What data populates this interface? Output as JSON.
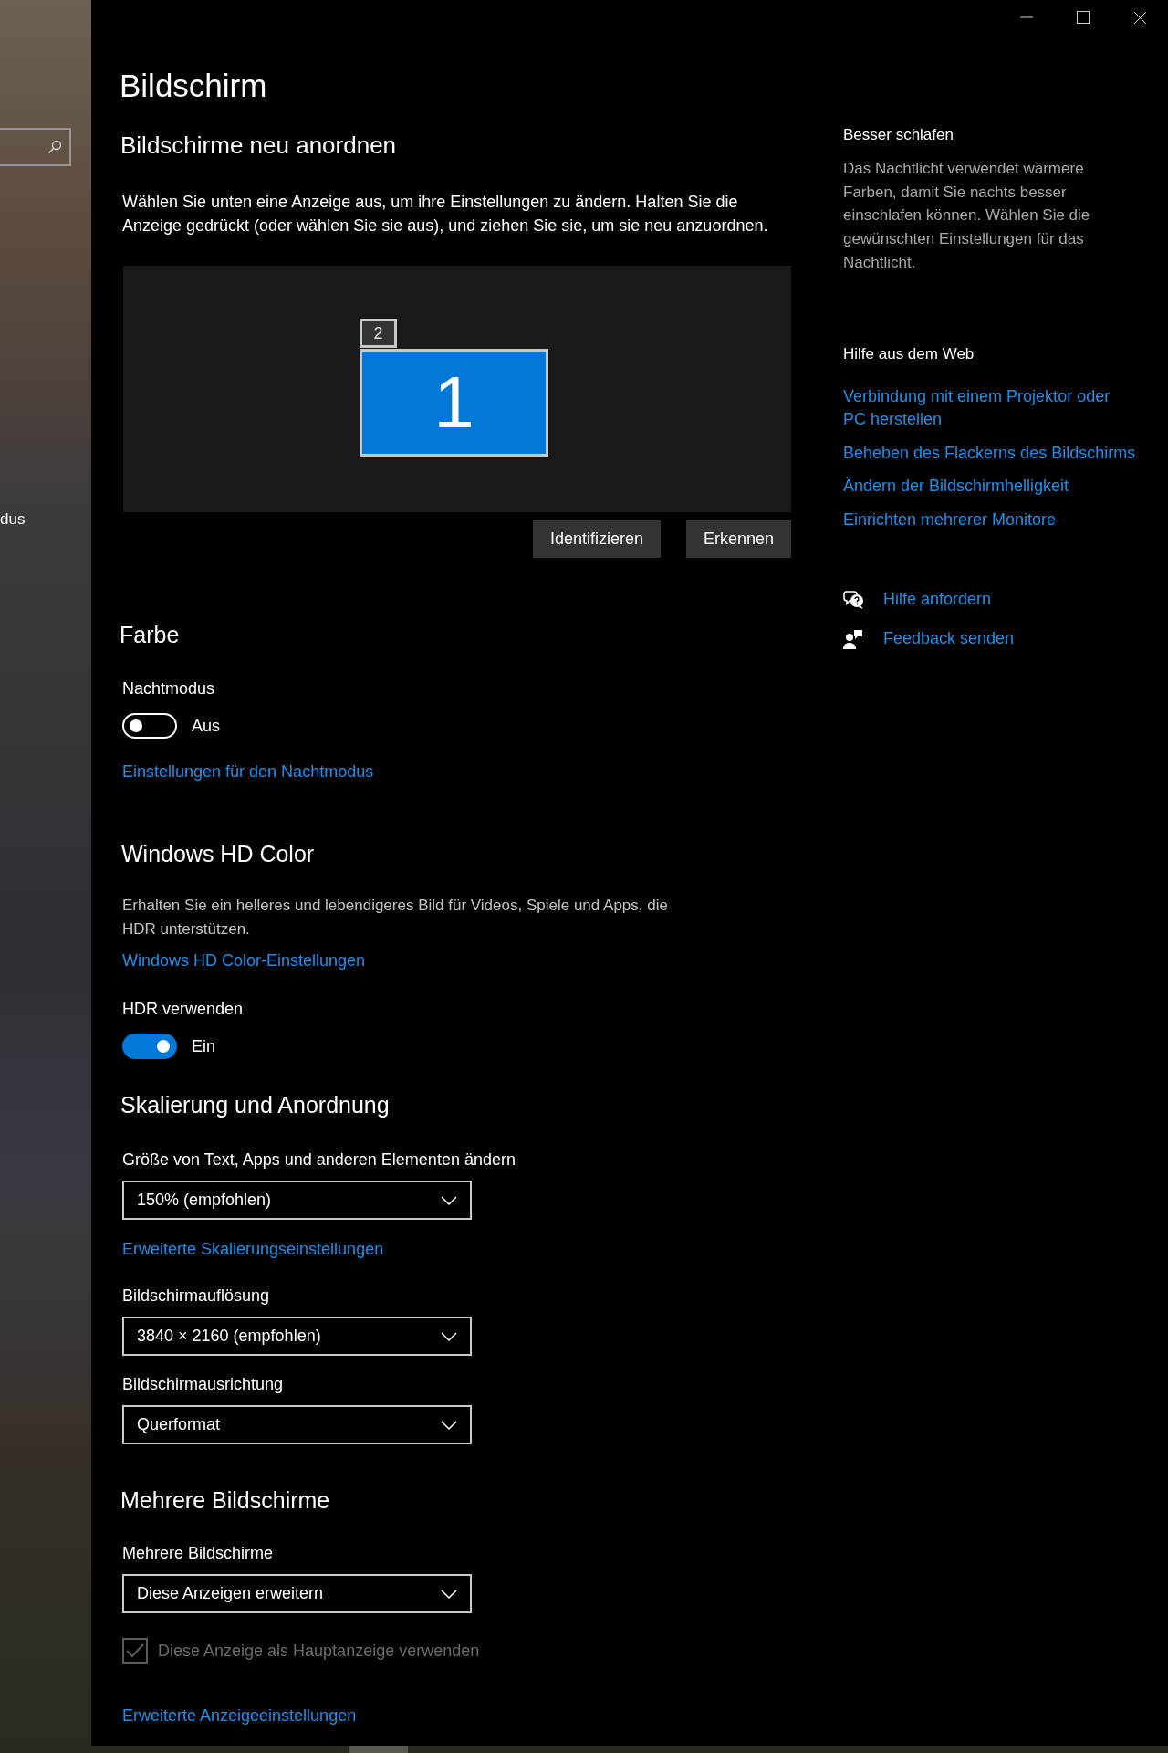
{
  "sidebar": {
    "items": [
      {
        "label": "dus"
      }
    ]
  },
  "page_title": "Bildschirm",
  "arrange": {
    "heading": "Bildschirme neu anordnen",
    "description": "Wählen Sie unten eine Anzeige aus, um ihre Einstellungen zu ändern. Halten Sie die Anzeige gedrückt (oder wählen Sie sie aus), und ziehen Sie sie, um sie neu anzuordnen.",
    "displays": [
      {
        "label": "2",
        "selected": false
      },
      {
        "label": "1",
        "selected": true
      }
    ],
    "buttons": [
      "Identifizieren",
      "Erkennen"
    ]
  },
  "color": {
    "heading": "Farbe",
    "night_mode": {
      "label": "Nachtmodus",
      "on": false,
      "state_text": "Aus"
    },
    "link": "Einstellungen für den Nachtmodus"
  },
  "hd_color": {
    "heading": "Windows HD Color",
    "description": "Erhalten Sie ein helleres und lebendigeres Bild für Videos, Spiele und Apps, die HDR unterstützen.",
    "link": "Windows HD Color-Einstellungen",
    "hdr": {
      "label": "HDR verwenden",
      "on": true,
      "state_text": "Ein"
    }
  },
  "scaling": {
    "heading": "Skalierung und Anordnung",
    "items": [
      {
        "kind": "dropdown",
        "label": "Größe von Text, Apps und anderen Elementen ändern",
        "value": "150% (empfohlen)"
      },
      {
        "kind": "link",
        "label": "Erweiterte Skalierungseinstellungen"
      },
      {
        "kind": "dropdown",
        "label": "Bildschirmauflösung",
        "value": "3840 × 2160 (empfohlen)"
      },
      {
        "kind": "dropdown",
        "label": "Bildschirmausrichtung",
        "value": "Querformat"
      }
    ]
  },
  "multiple": {
    "heading": "Mehrere Bildschirme",
    "label": "Mehrere Bildschirme",
    "value": "Diese Anzeigen erweitern",
    "checkbox": {
      "label": "Diese Anzeige als Hauptanzeige verwenden",
      "checked": true,
      "disabled": true
    },
    "link": "Erweiterte Anzeigeeinstellungen"
  },
  "side": {
    "sleep": {
      "heading": "Besser schlafen",
      "text": "Das Nachtlicht verwendet wärmere Farben, damit Sie nachts besser einschlafen können. Wählen Sie die gewünschten Einstellungen für das Nachtlicht."
    },
    "web_help": {
      "heading": "Hilfe aus dem Web",
      "links": [
        "Verbindung mit einem Projektor oder PC herstellen",
        "Beheben des Flackerns des Bildschirms",
        "Ändern der Bildschirmhelligkeit",
        "Einrichten mehrerer Monitore"
      ]
    },
    "actions": [
      {
        "kind": "help",
        "label": "Hilfe anfordern"
      },
      {
        "kind": "feedback",
        "label": "Feedback senden"
      }
    ]
  }
}
